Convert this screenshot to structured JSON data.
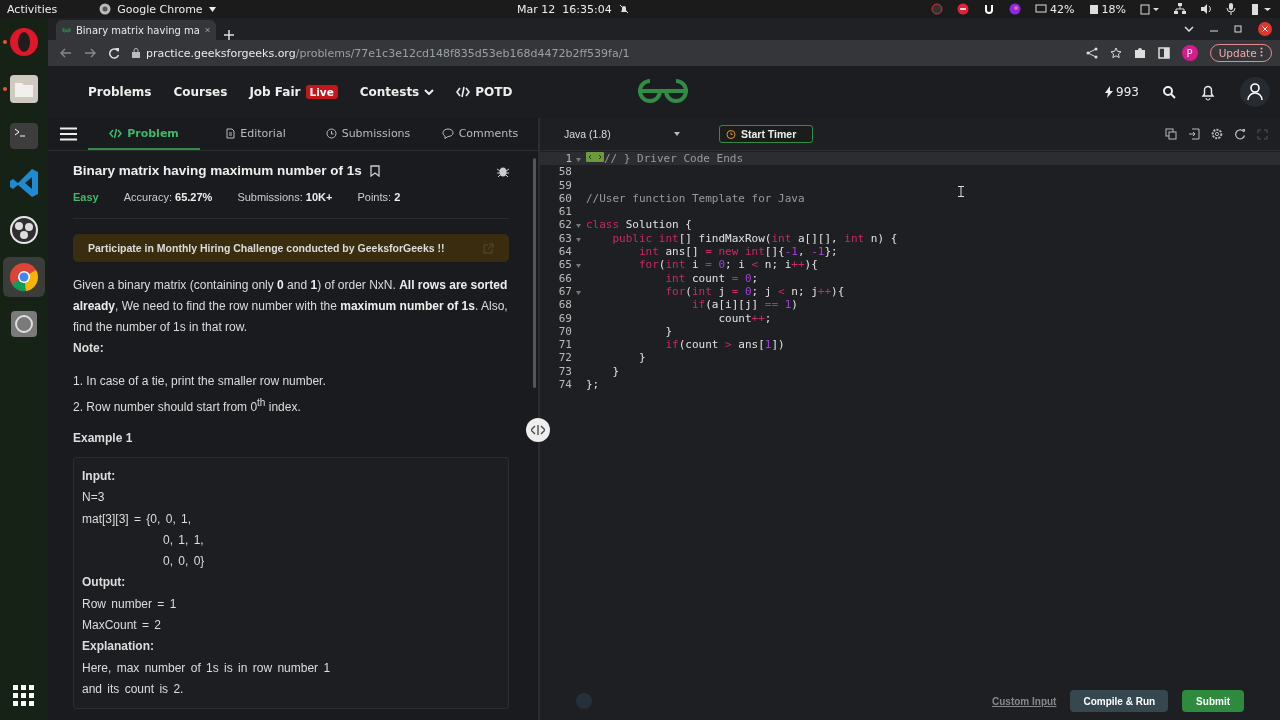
{
  "system_bar": {
    "activities": "Activities",
    "app_menu": "Google Chrome",
    "clock": "Mar 12  16:35:04",
    "cpu": "42%",
    "memory": "18%"
  },
  "dock": [
    {
      "kind": "opera",
      "running": true,
      "selected": false
    },
    {
      "kind": "files",
      "running": true,
      "selected": false
    },
    {
      "kind": "terminal",
      "running": false,
      "selected": false
    },
    {
      "kind": "vscode",
      "running": false,
      "selected": false
    },
    {
      "kind": "obs",
      "running": false,
      "selected": false
    },
    {
      "kind": "chrome",
      "running": false,
      "selected": true
    },
    {
      "kind": "disk",
      "running": false,
      "selected": false
    }
  ],
  "browser": {
    "tab_title": "Binary matrix having ma",
    "url_host": "practice.geeksforgeeks.org",
    "url_path": "/problems/77e1c3e12cd148f835d53eb168d4472b2ff539fa/1",
    "profile_initial": "P",
    "update_button": "Update"
  },
  "nav": {
    "links": [
      {
        "label": "Problems",
        "kind": "plain"
      },
      {
        "label": "Courses",
        "kind": "plain"
      },
      {
        "label": "Job Fair",
        "kind": "badge",
        "badge": "Live"
      },
      {
        "label": "Contests",
        "kind": "dropdown"
      },
      {
        "label": "POTD",
        "kind": "code"
      }
    ],
    "streak": "993"
  },
  "problem_tabs": [
    {
      "label": "Problem",
      "kind": "code",
      "selected": true
    },
    {
      "label": "Editorial",
      "kind": "doc",
      "selected": false
    },
    {
      "label": "Submissions",
      "kind": "clock",
      "selected": false
    },
    {
      "label": "Comments",
      "kind": "chat",
      "selected": false
    }
  ],
  "problem": {
    "title": "Binary matrix having maximum number of 1s",
    "difficulty": "Easy",
    "stats": [
      {
        "label": "Accuracy:",
        "value": "65.27%"
      },
      {
        "label": "Submissions:",
        "value": "10K+"
      },
      {
        "label": "Points:",
        "value": "2"
      }
    ],
    "banner": "Participate in Monthly Hiring Challenge conducted by GeeksforGeeks !!",
    "description": "Given a binary matrix (containing only **0** and **1**) of order NxN. **All rows are sorted already**, We need to find the row number with the **maximum number of 1s**. Also, find the number of 1s in that row.",
    "note_heading": "Note:",
    "notes": [
      "1. In case of a tie, print the smaller row number.",
      "2. Row number should start from 0$^{th}$ index."
    ],
    "example_heading": "Example 1",
    "example": [
      {
        "kind": "heading",
        "text": "Input:"
      },
      {
        "kind": "line",
        "text": "N=3"
      },
      {
        "kind": "line",
        "text": "mat[3][3] = {0, 0, 1,"
      },
      {
        "kind": "continued",
        "text": "0, 1, 1,"
      },
      {
        "kind": "continued",
        "text": "0, 0, 0}"
      },
      {
        "kind": "heading",
        "text": "Output:"
      },
      {
        "kind": "line",
        "text": "Row number = 1"
      },
      {
        "kind": "line",
        "text": "MaxCount = 2"
      },
      {
        "kind": "heading",
        "text": "Explanation:"
      },
      {
        "kind": "line",
        "text": "Here, max number of 1s is in row number 1"
      },
      {
        "kind": "line",
        "text": "and its count is 2."
      }
    ]
  },
  "editor": {
    "language": "Java (1.8)",
    "timer_button": "Start Timer",
    "lines": [
      {
        "number": "1",
        "foldable": true,
        "folded": true,
        "highlighted": true,
        "tokens": [
          {
            "kind": "comment",
            "text": "// } Driver Code Ends"
          }
        ]
      },
      {
        "number": "58",
        "foldable": false,
        "folded": false,
        "highlighted": false
      },
      {
        "number": "59",
        "foldable": false,
        "folded": false,
        "highlighted": false
      },
      {
        "number": "60",
        "foldable": false,
        "folded": false,
        "highlighted": false,
        "tokens": [
          {
            "kind": "comment",
            "text": "//User function Template for Java"
          }
        ]
      },
      {
        "number": "61",
        "foldable": false,
        "folded": false,
        "highlighted": false
      },
      {
        "number": "62",
        "foldable": true,
        "folded": false,
        "highlighted": false,
        "tokens": [
          {
            "kind": "keyword",
            "text": "class"
          },
          {
            "kind": "text",
            "text": " Solution {"
          }
        ],
        "children": [
          {
            "number": "63",
            "foldable": true,
            "folded": false,
            "highlighted": false,
            "tokens": [
              {
                "kind": "keyword",
                "text": "public int"
              },
              {
                "kind": "text",
                "text": "[] findMaxRow("
              },
              {
                "kind": "keyword",
                "text": "int"
              },
              {
                "kind": "text",
                "text": " a[][], "
              },
              {
                "kind": "keyword",
                "text": "int"
              },
              {
                "kind": "text",
                "text": " n) {"
              }
            ],
            "children": [
              {
                "number": "64",
                "foldable": false,
                "folded": false,
                "highlighted": false,
                "tokens": [
                  {
                    "kind": "keyword",
                    "text": "int"
                  },
                  {
                    "kind": "text",
                    "text": " ans[] "
                  },
                  {
                    "kind": "operator",
                    "text": "="
                  },
                  {
                    "kind": "keyword",
                    "text": " new int"
                  },
                  {
                    "kind": "text",
                    "text": "[]{"
                  },
                  {
                    "kind": "number",
                    "text": "-1"
                  },
                  {
                    "kind": "text",
                    "text": ", "
                  },
                  {
                    "kind": "number",
                    "text": "-1"
                  },
                  {
                    "kind": "text",
                    "text": "};"
                  }
                ]
              },
              {
                "number": "65",
                "foldable": true,
                "folded": false,
                "highlighted": false,
                "tokens": [
                  {
                    "kind": "keyword",
                    "text": "for"
                  },
                  {
                    "kind": "text",
                    "text": "("
                  },
                  {
                    "kind": "keyword",
                    "text": "int"
                  },
                  {
                    "kind": "text",
                    "text": " i "
                  },
                  {
                    "kind": "operator",
                    "text": "="
                  },
                  {
                    "kind": "number",
                    "text": " 0"
                  },
                  {
                    "kind": "text",
                    "text": "; i "
                  },
                  {
                    "kind": "operator",
                    "text": "<"
                  },
                  {
                    "kind": "text",
                    "text": " n; i"
                  },
                  {
                    "kind": "operator",
                    "text": "++"
                  },
                  {
                    "kind": "text",
                    "text": "){"
                  }
                ],
                "children": [
                  {
                    "number": "66",
                    "foldable": false,
                    "folded": false,
                    "highlighted": false,
                    "tokens": [
                      {
                        "kind": "keyword",
                        "text": "int"
                      },
                      {
                        "kind": "text",
                        "text": " count "
                      },
                      {
                        "kind": "operator",
                        "text": "="
                      },
                      {
                        "kind": "number",
                        "text": " 0"
                      },
                      {
                        "kind": "text",
                        "text": ";"
                      }
                    ]
                  },
                  {
                    "number": "67",
                    "foldable": true,
                    "folded": false,
                    "highlighted": false,
                    "tokens": [
                      {
                        "kind": "keyword",
                        "text": "for"
                      },
                      {
                        "kind": "text",
                        "text": "("
                      },
                      {
                        "kind": "keyword",
                        "text": "int"
                      },
                      {
                        "kind": "text",
                        "text": " j "
                      },
                      {
                        "kind": "operator",
                        "text": "="
                      },
                      {
                        "kind": "number",
                        "text": " 0"
                      },
                      {
                        "kind": "text",
                        "text": "; j "
                      },
                      {
                        "kind": "operator",
                        "text": "<"
                      },
                      {
                        "kind": "text",
                        "text": " n; j"
                      },
                      {
                        "kind": "operator",
                        "text": "++"
                      },
                      {
                        "kind": "text",
                        "text": "){"
                      }
                    ],
                    "children": [
                      {
                        "number": "68",
                        "foldable": false,
                        "folded": false,
                        "highlighted": false,
                        "tokens": [
                          {
                            "kind": "keyword",
                            "text": "if"
                          },
                          {
                            "kind": "text",
                            "text": "(a[i][j] "
                          },
                          {
                            "kind": "operator",
                            "text": "=="
                          },
                          {
                            "kind": "number",
                            "text": " 1"
                          },
                          {
                            "kind": "text",
                            "text": ")"
                          }
                        ],
                        "children": [
                          {
                            "number": "69",
                            "foldable": false,
                            "folded": false,
                            "highlighted": false,
                            "tokens": [
                              {
                                "kind": "text",
                                "text": "count"
                              },
                              {
                                "kind": "operator",
                                "text": "++"
                              },
                              {
                                "kind": "text",
                                "text": ";"
                              }
                            ]
                          }
                        ]
                      }
                    ]
                  },
                  {
                    "number": "70",
                    "foldable": false,
                    "folded": false,
                    "highlighted": false,
                    "tokens": [
                      {
                        "kind": "text",
                        "text": "}"
                      }
                    ]
                  },
                  {
                    "number": "71",
                    "foldable": false,
                    "folded": false,
                    "highlighted": false,
                    "tokens": [
                      {
                        "kind": "keyword",
                        "text": "if"
                      },
                      {
                        "kind": "text",
                        "text": "(count "
                      },
                      {
                        "kind": "operator",
                        "text": ">"
                      },
                      {
                        "kind": "text",
                        "text": " ans["
                      },
                      {
                        "kind": "number",
                        "text": "1"
                      },
                      {
                        "kind": "text",
                        "text": "])"
                      }
                    ]
                  }
                ]
              },
              {
                "number": "72",
                "foldable": false,
                "folded": false,
                "highlighted": false,
                "tokens": [
                  {
                    "kind": "text",
                    "text": "}"
                  }
                ]
              }
            ]
          },
          {
            "number": "73",
            "foldable": false,
            "folded": false,
            "highlighted": false,
            "tokens": [
              {
                "kind": "text",
                "text": "}"
              }
            ]
          }
        ]
      },
      {
        "number": "74",
        "foldable": false,
        "folded": false,
        "highlighted": false,
        "tokens": [
          {
            "kind": "text",
            "text": "};"
          }
        ]
      }
    ]
  },
  "footer": {
    "custom_input": "Custom Input",
    "compile_button": "Compile & Run",
    "submit_button": "Submit"
  }
}
